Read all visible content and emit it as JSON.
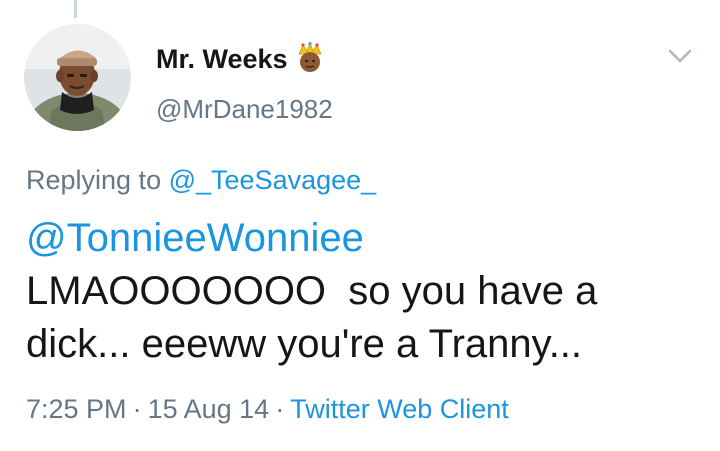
{
  "tweet": {
    "author": {
      "display_name": "Mr. Weeks",
      "handle": "@MrDane1982",
      "badge_icon": "crown-emoji-icon"
    },
    "replying_to": {
      "prefix": "Replying to",
      "handle": "@_TeeSavagee_"
    },
    "text": {
      "mention": "@TonnieeWonniee",
      "line2": "LMAOOOOOOO  so you have a",
      "line3": "dick... eeeww you're a Tranny..."
    },
    "meta": {
      "time": "7:25 PM",
      "separator": "·",
      "date": "15 Aug 14",
      "source": "Twitter Web Client"
    },
    "menu_icon": "chevron-down-icon"
  },
  "colors": {
    "text": "#14171a",
    "secondary": "#657786",
    "link": "#1b95e0",
    "thread_line": "#ccd6dd"
  }
}
